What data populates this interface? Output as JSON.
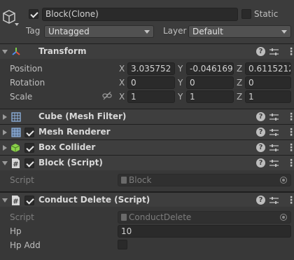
{
  "gameobject": {
    "name": "Block(Clone)",
    "active": true,
    "static_label": "Static",
    "static_checked": false,
    "tag_label": "Tag",
    "tag_value": "Untagged",
    "layer_label": "Layer",
    "layer_value": "Default"
  },
  "transform": {
    "title": "Transform",
    "position_label": "Position",
    "rotation_label": "Rotation",
    "scale_label": "Scale",
    "axis_x": "X",
    "axis_y": "Y",
    "axis_z": "Z",
    "position": {
      "x": "3.035752",
      "y": "-0.046169",
      "z": "0.6115212"
    },
    "rotation": {
      "x": "0",
      "y": "0",
      "z": "0"
    },
    "scale": {
      "x": "1",
      "y": "1",
      "z": "1"
    }
  },
  "components": {
    "mesh_filter": {
      "title": "Cube (Mesh Filter)"
    },
    "mesh_renderer": {
      "title": "Mesh Renderer",
      "enabled": true
    },
    "box_collider": {
      "title": "Box Collider",
      "enabled": true
    },
    "block_script": {
      "title": "Block (Script)",
      "enabled": true,
      "script_label": "Script",
      "script_value": "Block"
    },
    "conduct_delete": {
      "title": "Conduct Delete (Script)",
      "enabled": true,
      "script_label": "Script",
      "script_value": "ConductDelete",
      "hp_label": "Hp",
      "hp_value": "10",
      "hp_add_label": "Hp Add",
      "hp_add_checked": false
    }
  },
  "icons": {
    "help": "?",
    "menu": "⋮"
  },
  "colors": {
    "background": "#383838",
    "header": "#3e3e3e",
    "field": "#2a2a2a",
    "transform_red": "#e5533b",
    "transform_green": "#7fd34a",
    "transform_blue": "#4a8ff0",
    "collider_green": "#8ad04a",
    "renderer_blue": "#8fb3e0"
  }
}
